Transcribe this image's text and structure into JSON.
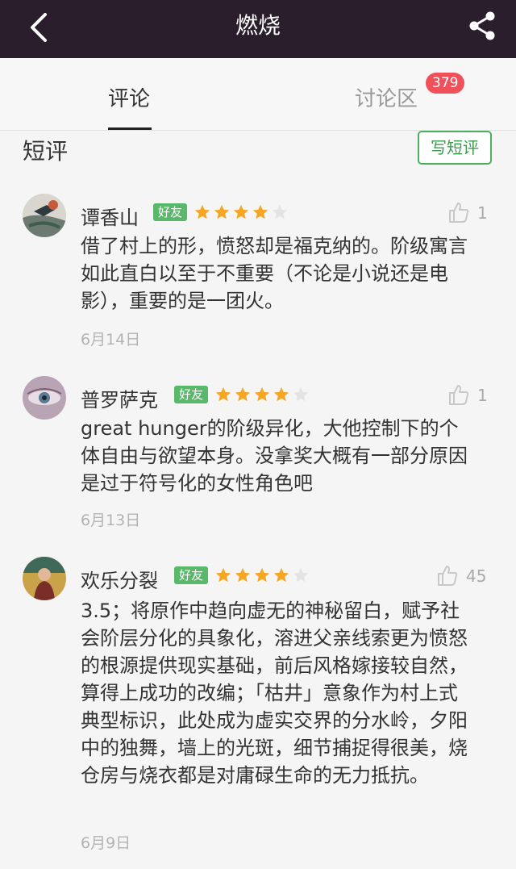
{
  "header": {
    "title": "燃烧"
  },
  "tabs": {
    "reviews": "评论",
    "discussion": "讨论区",
    "discussion_badge": "379"
  },
  "section": {
    "title": "短评",
    "write_label": "写短评"
  },
  "reviews": [
    {
      "name": "谭香山",
      "friend_tag": "好友",
      "rating": 4,
      "likes": "1",
      "text": "借了村上的形，愤怒却是福克纳的。阶级寓言如此直白以至于不重要（不论是小说还是电影），重要的是一团火。",
      "date": "6月14日"
    },
    {
      "name": "普罗萨克",
      "friend_tag": "好友",
      "rating": 4,
      "likes": "1",
      "text": "great hunger的阶级异化，大他控制下的个体自由与欲望本身。没拿奖大概有一部分原因是过于符号化的女性角色吧",
      "date": "6月13日"
    },
    {
      "name": "欢乐分裂",
      "friend_tag": "好友",
      "rating": 4,
      "likes": "45",
      "text": "3.5；将原作中趋向虚无的神秘留白，赋予社会阶层分化的具象化，溶进父亲线索更为愤怒的根源提供现实基础，前后风格嫁接较自然，算得上成功的改编；「枯井」意象作为村上式典型标识，此处成为虚实交界的分水岭，夕阳中的独舞，墙上的光斑，细节捕捉得很美，烧仓房与烧衣都是对庸碌生命的无力抵抗。",
      "date": "6月9日"
    }
  ]
}
